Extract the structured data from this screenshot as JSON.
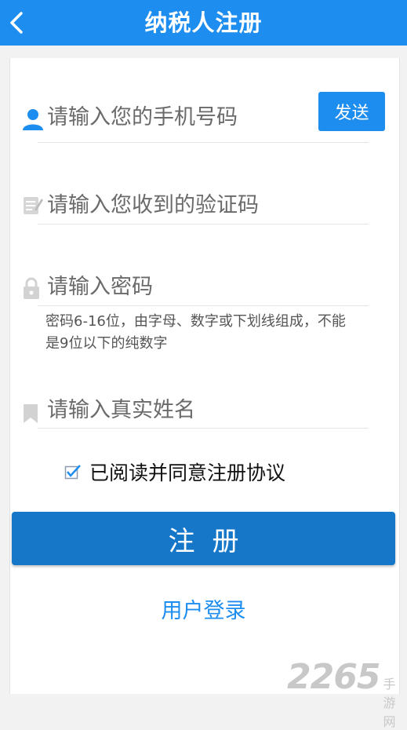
{
  "header": {
    "title": "纳税人注册"
  },
  "form": {
    "phone_placeholder": "请输入您的手机号码",
    "send_label": "发送",
    "code_placeholder": "请输入您收到的验证码",
    "password_placeholder": "请输入密码",
    "password_hint": "密码6-16位，由字母、数字或下划线组成，不能是9位以下的纯数字",
    "name_placeholder": "请输入真实姓名",
    "agreement_label": "已阅读并同意注册协议",
    "agreement_checked": true,
    "register_label": "注册",
    "login_label": "用户登录"
  },
  "watermark": {
    "number": "2265",
    "text": "手游网"
  },
  "colors": {
    "primary": "#1d8df0",
    "register_button": "#1677c9"
  }
}
